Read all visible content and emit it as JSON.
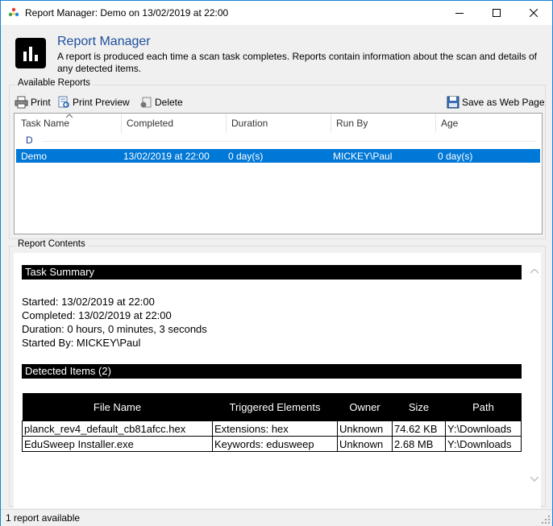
{
  "window": {
    "title": "Report Manager: Demo on 13/02/2019 at 22:00"
  },
  "header": {
    "title": "Report Manager",
    "description": "A report is produced each time a scan task completes. Reports contain information about the scan and details of any detected items."
  },
  "available_reports": {
    "label": "Available Reports",
    "toolbar": {
      "print": "Print",
      "print_preview": "Print Preview",
      "delete": "Delete",
      "save_web": "Save as Web Page"
    },
    "columns": [
      "Task Name",
      "Completed",
      "Duration",
      "Run By",
      "Age"
    ],
    "group_letter": "D",
    "rows": [
      {
        "task_name": "Demo",
        "completed": "13/02/2019 at 22:00",
        "duration": "0 day(s)",
        "run_by": "MICKEY\\Paul",
        "age": "0 day(s)"
      }
    ]
  },
  "report_contents": {
    "label": "Report Contents",
    "task_summary": {
      "heading": "Task Summary",
      "started": "Started: 13/02/2019 at 22:00",
      "completed": "Completed: 13/02/2019 at 22:00",
      "duration": "Duration: 0 hours, 0 minutes, 3 seconds",
      "started_by": "Started By: MICKEY\\Paul"
    },
    "detected": {
      "heading": "Detected Items (2)",
      "columns": [
        "File Name",
        "Triggered Elements",
        "Owner",
        "Size",
        "Path"
      ],
      "rows": [
        [
          "planck_rev4_default_cb81afcc.hex",
          "Extensions: hex",
          "Unknown",
          "74.62 KB",
          "Y:\\Downloads"
        ],
        [
          "EduSweep Installer.exe",
          "Keywords: edusweep",
          "Unknown",
          "2.68 MB",
          "Y:\\Downloads"
        ]
      ]
    }
  },
  "status": {
    "text": "1 report available"
  },
  "colors": {
    "accent": "#0078d7",
    "header_title": "#1d4f9c",
    "window_border": "#1883d7"
  }
}
